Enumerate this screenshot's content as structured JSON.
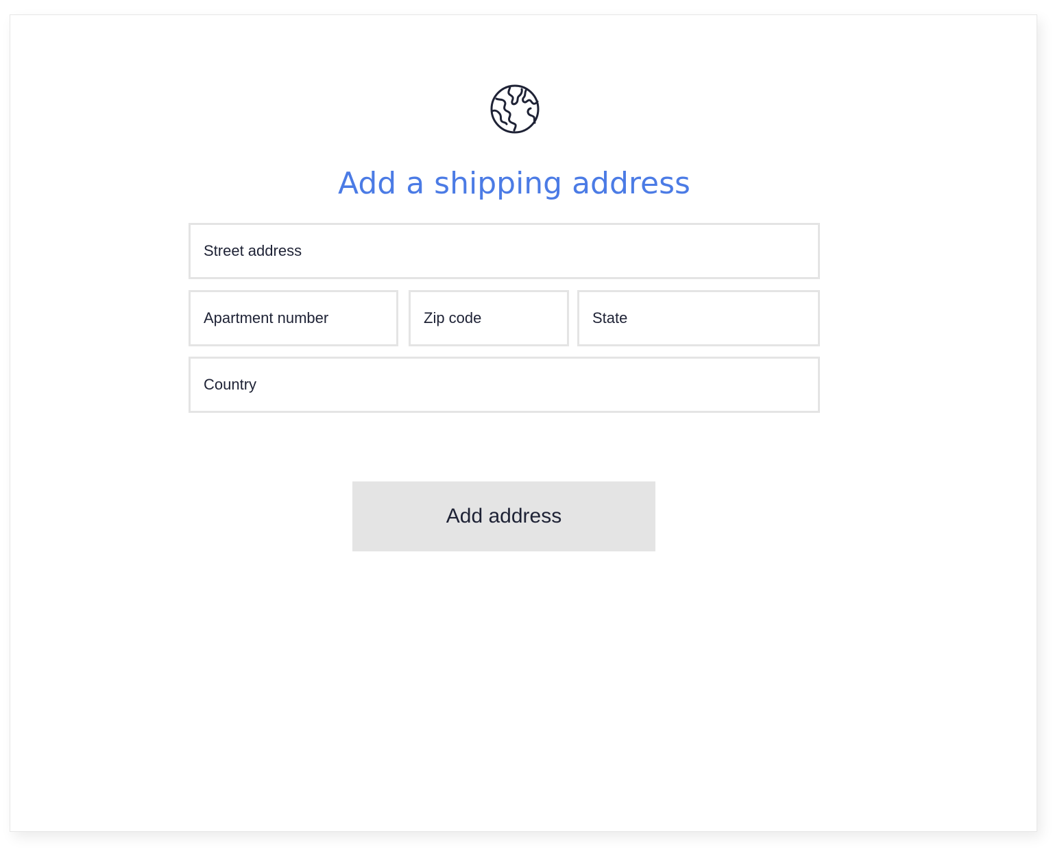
{
  "header": {
    "icon": "globe-icon",
    "title": "Add a shipping address"
  },
  "form": {
    "street_placeholder": "Street address",
    "apartment_placeholder": "Apartment number",
    "zip_placeholder": "Zip code",
    "state_placeholder": "State",
    "country_placeholder": "Country",
    "submit_label": "Add address"
  },
  "colors": {
    "accent": "#4b7be5",
    "text": "#1e2235",
    "field_border": "#e4e4e4",
    "button_bg": "#e4e4e4"
  }
}
